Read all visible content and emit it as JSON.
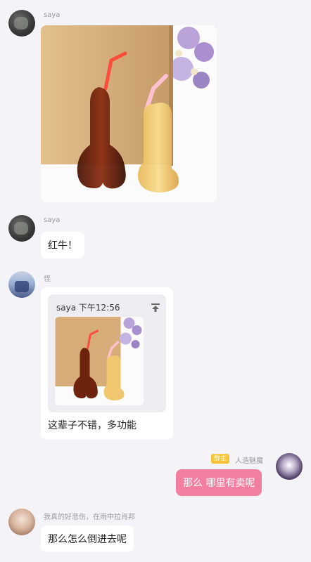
{
  "messages": [
    {
      "sender": "saya",
      "type": "image",
      "image_desc": ""
    },
    {
      "sender": "saya",
      "type": "text",
      "text": "红牛！"
    },
    {
      "sender": "怪",
      "type": "quote",
      "quote": {
        "sender": "saya",
        "time": "下午12:56"
      },
      "text": "这辈子不错，多功能"
    },
    {
      "sender": "人造魅魔",
      "badge": "群主",
      "type": "text",
      "text": "那么 哪里有卖呢",
      "is_self": true
    },
    {
      "sender": "我真的好悲伤，在雨中拉肖邦",
      "type": "text",
      "text": "那么怎么倒进去呢"
    }
  ],
  "colors": {
    "background": "#f4f3f8",
    "self_bubble": "#f27ea0",
    "badge": "#f6c437"
  }
}
